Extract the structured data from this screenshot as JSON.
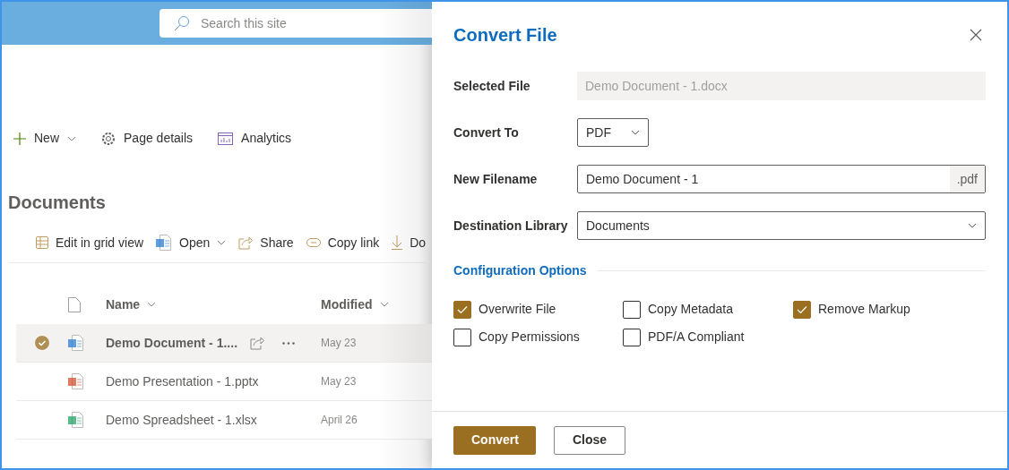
{
  "header": {
    "search": {
      "placeholder": "Search this site"
    }
  },
  "page_commands": [
    {
      "kind": "new",
      "label": "New",
      "dropdown": true
    },
    {
      "kind": "settings",
      "label": "Page details",
      "dropdown": false
    },
    {
      "kind": "analytics",
      "label": "Analytics",
      "dropdown": false
    }
  ],
  "library": {
    "title": "Documents",
    "commands": [
      {
        "kind": "grid",
        "label": "Edit in grid view",
        "dropdown": false
      },
      {
        "kind": "word",
        "label": "Open",
        "dropdown": true
      },
      {
        "kind": "share",
        "label": "Share",
        "dropdown": false
      },
      {
        "kind": "link",
        "label": "Copy link",
        "dropdown": false
      },
      {
        "kind": "download",
        "label": "Do",
        "dropdown": false
      }
    ],
    "columns": [
      {
        "label": "Name"
      },
      {
        "label": "Modified"
      }
    ],
    "rows": [
      {
        "kind": "word",
        "name": "Demo Document - 1....",
        "modified": "May 23",
        "selected": true
      },
      {
        "kind": "powerpoint",
        "name": "Demo Presentation - 1.pptx",
        "modified": "May 23",
        "selected": false
      },
      {
        "kind": "excel",
        "name": "Demo Spreadsheet - 1.xlsx",
        "modified": "April 26",
        "selected": false
      }
    ]
  },
  "panel": {
    "title": "Convert File",
    "fields": [
      {
        "kind": "readonly",
        "label": "Selected File",
        "value": "Demo Document - 1.docx",
        "disabled": true
      },
      {
        "kind": "select_small",
        "label": "Convert To",
        "value": "PDF"
      },
      {
        "kind": "text_suffix",
        "label": "New Filename",
        "value": "Demo Document - 1",
        "suffix": ".pdf"
      },
      {
        "kind": "select",
        "label": "Destination Library",
        "value": "Documents"
      }
    ],
    "section_title": "Configuration Options",
    "options": [
      {
        "label": "Overwrite File",
        "checked": true
      },
      {
        "label": "Copy Metadata",
        "checked": false
      },
      {
        "label": "Remove Markup",
        "checked": true
      },
      {
        "label": "Copy Permissions",
        "checked": false
      },
      {
        "label": "PDF/A Compliant",
        "checked": false
      }
    ],
    "buttons": [
      {
        "kind": "primary",
        "label": "Convert"
      },
      {
        "kind": "secondary",
        "label": "Close"
      }
    ]
  }
}
